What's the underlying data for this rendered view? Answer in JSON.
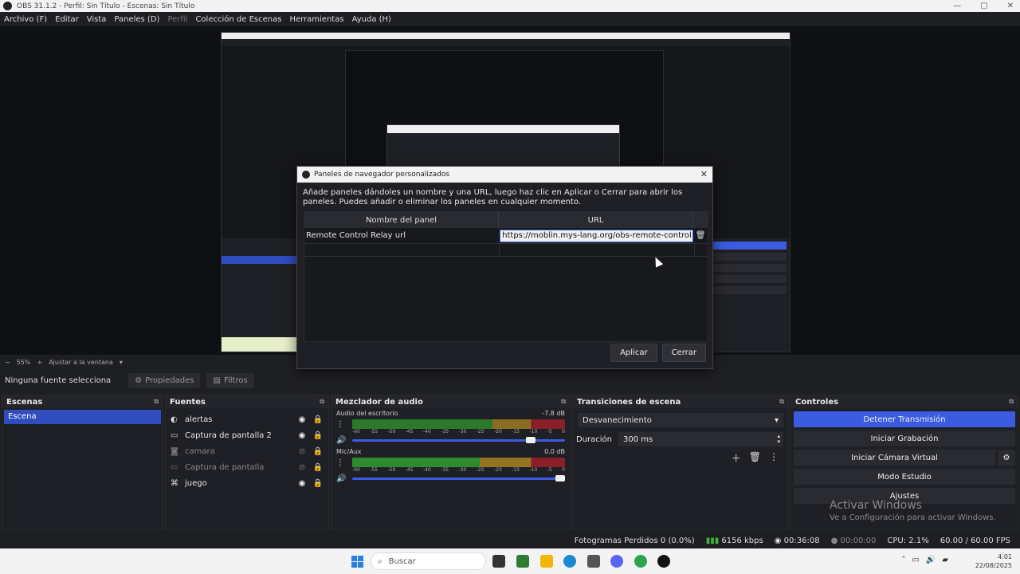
{
  "window": {
    "title": "OBS 31.1.2 - Perfil: Sin Título - Escenas: Sin Título"
  },
  "menu": {
    "items": [
      "Archivo (F)",
      "Editar",
      "Vista",
      "Paneles (D)",
      "Perfil",
      "Colección de Escenas",
      "Herramientas",
      "Ayuda (H)"
    ]
  },
  "zoom": {
    "minus": "−",
    "value": "55%",
    "plus": "+",
    "fit": "Ajustar a la ventana"
  },
  "props": {
    "status": "Ninguna fuente selecciona",
    "properties": "Propiedades",
    "filters": "Filtros"
  },
  "scenes": {
    "title": "Escenas",
    "items": [
      "Escena"
    ]
  },
  "sources": {
    "title": "Fuentes",
    "items": [
      {
        "name": "alertas",
        "visible": true,
        "dim": false
      },
      {
        "name": "Captura de pantalla 2",
        "visible": true,
        "dim": false
      },
      {
        "name": "camara",
        "visible": false,
        "dim": true
      },
      {
        "name": "Captura de pantalla",
        "visible": false,
        "dim": true
      },
      {
        "name": "juego",
        "visible": true,
        "dim": false
      }
    ]
  },
  "mixer": {
    "title": "Mezclador de audio",
    "ticks": [
      "-60",
      "-55",
      "-50",
      "-45",
      "-40",
      "-35",
      "-30",
      "-25",
      "-20",
      "-15",
      "-10",
      "-5",
      "0"
    ],
    "tracks": [
      {
        "name": "Audio del escritorio",
        "db": "-7.8 dB",
        "level": 0.86
      },
      {
        "name": "Mic/Aux",
        "db": "0.0 dB",
        "level": 1.0
      }
    ]
  },
  "transitions": {
    "title": "Transiciones de escena",
    "selected": "Desvanecimiento",
    "duration_label": "Duración",
    "duration": "300 ms"
  },
  "controls": {
    "title": "Controles",
    "stop_stream": "Detener Transmisión",
    "start_recording": "Iniciar Grabación",
    "start_virtualcam": "Iniciar Cámara Virtual",
    "studio_mode": "Modo Estudio",
    "settings": "Ajustes"
  },
  "watermark": {
    "title": "Activar Windows",
    "subtitle": "Ve a Configuración para activar Windows."
  },
  "status": {
    "dropped": "Fotogramas Perdidos 0 (0.0%)",
    "bitrate": "6156 kbps",
    "stream_time": "00:36:08",
    "rec_time": "00:00:00",
    "cpu": "CPU: 2.1%",
    "fps": "60.00 / 60.00 FPS"
  },
  "dialog": {
    "title": "Paneles de navegador personalizados",
    "description": "Añade paneles dándoles un nombre y una URL, luego haz clic en Aplicar o Cerrar para abrir los paneles. Puedes añadir o eliminar los paneles en cualquier momento.",
    "col_name": "Nombre del panel",
    "col_url": "URL",
    "rows": [
      {
        "name": "Remote Control Relay url",
        "url": "https://moblin.mys-lang.org/obs-remote-control"
      }
    ],
    "apply": "Aplicar",
    "close": "Cerrar"
  },
  "taskbar": {
    "search_placeholder": "Buscar",
    "time": "4:01",
    "date": "22/08/2025"
  },
  "colors": {
    "accent": "#3b5ce0",
    "scene_selected": "#2f4dbf"
  }
}
